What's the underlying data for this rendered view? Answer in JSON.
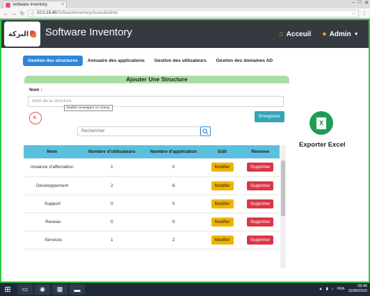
{
  "browser": {
    "tab_title": "Software Inventory",
    "tab_close": "×",
    "url_host": "10.0.19.40",
    "url_path": "/SoftwareInventory/AcceuilAdmin",
    "win_min": "–",
    "win_max": "□",
    "win_close": "✕"
  },
  "header": {
    "logo_text": "البركة",
    "title": "Software Inventory",
    "home_label": "Acceuil",
    "user_label": "Admin"
  },
  "nav": {
    "tabs": [
      {
        "label": "Gestion des structures",
        "active": true
      },
      {
        "label": "Annuaire des applications",
        "active": false
      },
      {
        "label": "Gestion des utilisateurs",
        "active": false
      },
      {
        "label": "Gestion des domaines AD",
        "active": false
      }
    ]
  },
  "form": {
    "card_title": "Ajouter Une Structure",
    "nom_label": "Nom :",
    "nom_placeholder": "Nom de la structure",
    "validation_tooltip": "Veuillez renseigner ce champ.",
    "collapse_glyph": "«",
    "save_label": "Enregistrer"
  },
  "search": {
    "placeholder": "Rechercher"
  },
  "table": {
    "headers": [
      "Nom",
      "Nombre d'utilisateurs",
      "Nombre d'application",
      "Edit",
      "Remove"
    ],
    "rows": [
      {
        "nom": "instance d'affectation",
        "users": "1",
        "apps": "0",
        "edit": "Modifier",
        "remove": "Supprimer"
      },
      {
        "nom": "Developpement",
        "users": "2",
        "apps": "6",
        "edit": "Modifier",
        "remove": "Supprimer"
      },
      {
        "nom": "Support",
        "users": "0",
        "apps": "0",
        "edit": "Modifier",
        "remove": "Supprimer"
      },
      {
        "nom": "Reseau",
        "users": "0",
        "apps": "0",
        "edit": "Modifier",
        "remove": "Supprimer"
      },
      {
        "nom": "Services",
        "users": "1",
        "apps": "2",
        "edit": "Modifier",
        "remove": "Supprimer"
      }
    ]
  },
  "export": {
    "label": "Exporter Excel",
    "icon_letter": "X"
  },
  "taskbar": {
    "lang": "FRA",
    "time": "09:46",
    "date": "15/08/2019"
  },
  "colors": {
    "header_bg": "#343a40",
    "active_tab": "#2f86d8",
    "card_header": "#a9dfa3",
    "table_header": "#5bc0de",
    "modify_btn": "#f0b400",
    "delete_btn": "#dc3545",
    "save_btn": "#34a4b7",
    "excel_green": "#1f9d55"
  }
}
